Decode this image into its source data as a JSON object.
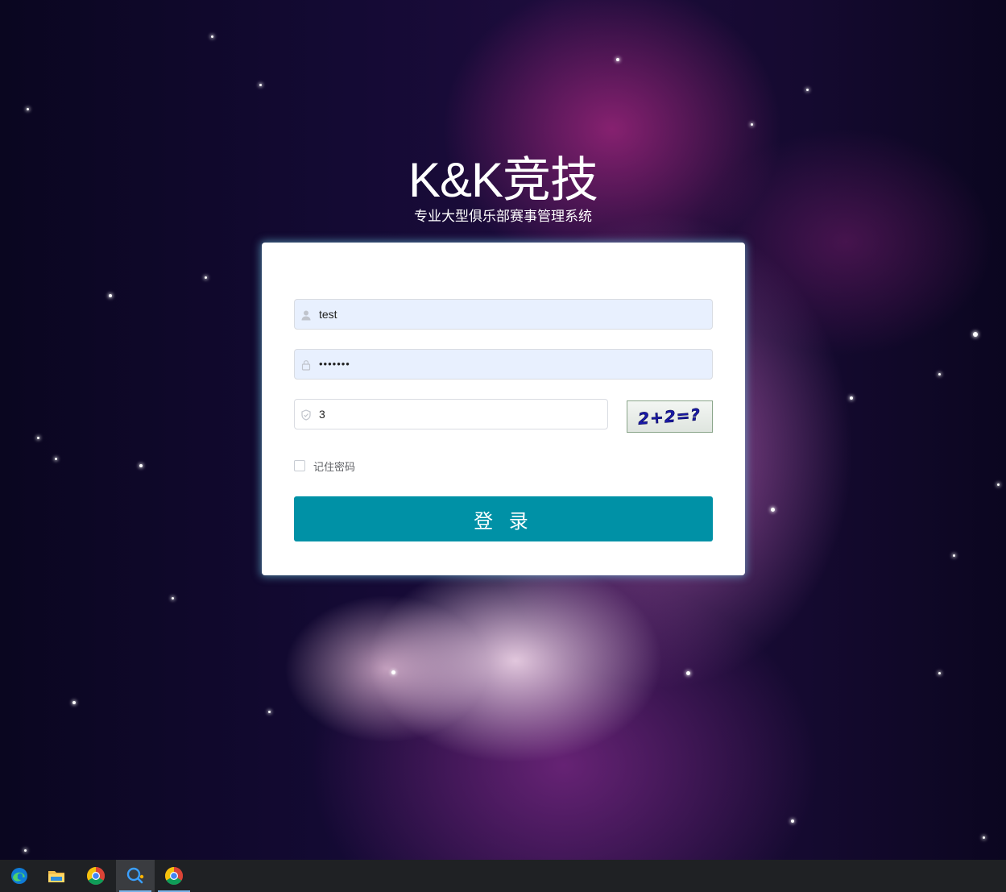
{
  "brand": {
    "title": "K&K竞技",
    "subtitle": "专业大型俱乐部赛事管理系统"
  },
  "login_form": {
    "username_value": "test",
    "password_value": "•••••••",
    "captcha_input_value": "3",
    "captcha_image_text": "2+2=?",
    "remember_label": "记住密码",
    "remember_checked": false,
    "login_button_label": "登 录",
    "button_color": "#0091a6",
    "autofill_bg": "#e8f0fe"
  },
  "taskbar": {
    "apps": [
      {
        "name": "edge-icon",
        "active": false
      },
      {
        "name": "file-explorer-icon",
        "active": false
      },
      {
        "name": "chrome-icon",
        "active": false
      },
      {
        "name": "search-app-icon",
        "active": true
      },
      {
        "name": "chrome-icon",
        "active": false
      }
    ]
  }
}
